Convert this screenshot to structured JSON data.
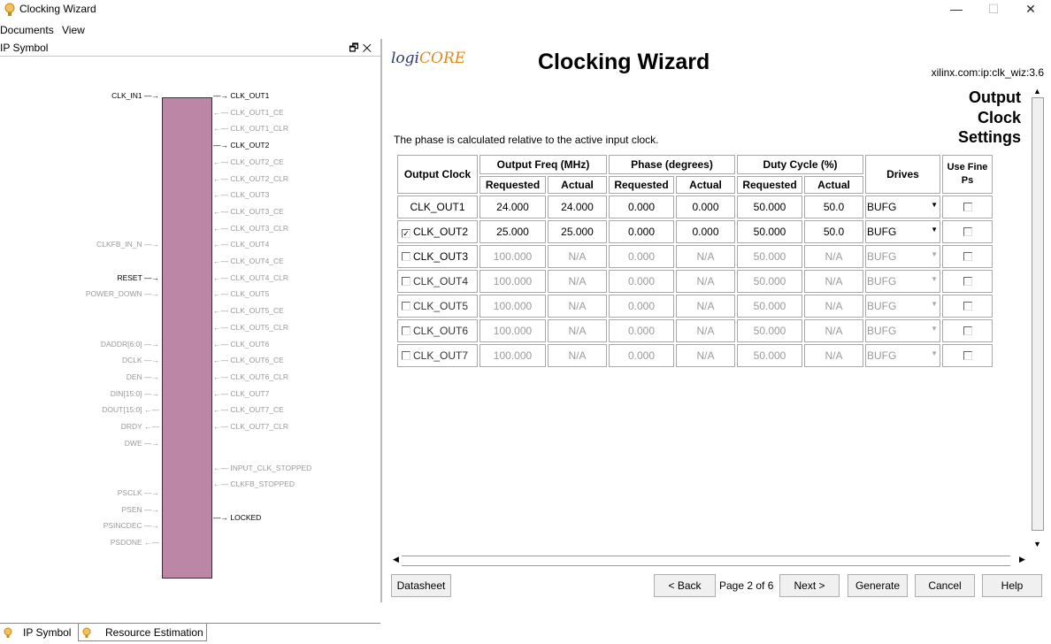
{
  "window": {
    "title": "Clocking Wizard",
    "controls": {
      "minimize": "—",
      "maximize": "☐",
      "close": "✕"
    }
  },
  "menu": [
    "Documents",
    "View"
  ],
  "left_panel": {
    "title": "IP Symbol",
    "header_buttons": "🗗✕",
    "inputs": [
      {
        "name": "CLK_IN1",
        "active": true
      },
      {
        "name": "CLKFB_IN_N",
        "active": false
      },
      {
        "name": "RESET",
        "active": true
      },
      {
        "name": "POWER_DOWN",
        "active": false
      },
      {
        "name": "DADDR[6:0]",
        "active": false
      },
      {
        "name": "DCLK",
        "active": false
      },
      {
        "name": "DEN",
        "active": false
      },
      {
        "name": "DIN[15:0]",
        "active": false
      },
      {
        "name": "DOUT[15:0]",
        "active": false
      },
      {
        "name": "DRDY",
        "active": false
      },
      {
        "name": "DWE",
        "active": false
      },
      {
        "name": "PSCLK",
        "active": false
      },
      {
        "name": "PSEN",
        "active": false
      },
      {
        "name": "PSINCDEC",
        "active": false
      },
      {
        "name": "PSDONE",
        "active": false
      }
    ],
    "outputs": [
      {
        "name": "CLK_OUT1",
        "active": true
      },
      {
        "name": "CLK_OUT1_CE",
        "active": false
      },
      {
        "name": "CLK_OUT1_CLR",
        "active": false
      },
      {
        "name": "CLK_OUT2",
        "active": true
      },
      {
        "name": "CLK_OUT2_CE",
        "active": false
      },
      {
        "name": "CLK_OUT2_CLR",
        "active": false
      },
      {
        "name": "CLK_OUT3",
        "active": false
      },
      {
        "name": "CLK_OUT3_CE",
        "active": false
      },
      {
        "name": "CLK_OUT3_CLR",
        "active": false
      },
      {
        "name": "CLK_OUT4",
        "active": false
      },
      {
        "name": "CLK_OUT4_CE",
        "active": false
      },
      {
        "name": "CLK_OUT4_CLR",
        "active": false
      },
      {
        "name": "CLK_OUT5",
        "active": false
      },
      {
        "name": "CLK_OUT5_CE",
        "active": false
      },
      {
        "name": "CLK_OUT5_CLR",
        "active": false
      },
      {
        "name": "CLK_OUT6",
        "active": false
      },
      {
        "name": "CLK_OUT6_CE",
        "active": false
      },
      {
        "name": "CLK_OUT6_CLR",
        "active": false
      },
      {
        "name": "CLK_OUT7",
        "active": false
      },
      {
        "name": "CLK_OUT7_CE",
        "active": false
      },
      {
        "name": "CLK_OUT7_CLR",
        "active": false
      },
      {
        "name": "INPUT_CLK_STOPPED",
        "active": false
      },
      {
        "name": "CLKFB_STOPPED",
        "active": false
      },
      {
        "name": "LOCKED",
        "active": true
      }
    ],
    "tabs": [
      "IP Symbol",
      "Resource Estimation"
    ]
  },
  "right_panel": {
    "logo_a": "logi",
    "logo_b": "CORE",
    "title": "Clocking Wizard",
    "ip_id": "xilinx.com:ip:clk_wiz:3.6",
    "section_line1": "Output",
    "section_line2": "Clock",
    "section_line3": "Settings",
    "phase_note": "The phase is calculated relative to the active input clock.",
    "headers": {
      "output_clock": "Output Clock",
      "output_freq": "Output Freq (MHz)",
      "phase": "Phase (degrees)",
      "duty": "Duty Cycle (%)",
      "drives": "Drives",
      "use_fine_ps": "Use Fine Ps",
      "requested": "Requested",
      "actual": "Actual"
    },
    "rows": [
      {
        "name": "CLK_OUT1",
        "enabled": true,
        "has_check": false,
        "checked": false,
        "freq_req": "24.000",
        "freq_act": "24.000",
        "phase_req": "0.000",
        "phase_act": "0.000",
        "duty_req": "50.000",
        "duty_act": "50.0",
        "drives": "BUFG"
      },
      {
        "name": "CLK_OUT2",
        "enabled": true,
        "has_check": true,
        "checked": true,
        "freq_req": "25.000",
        "freq_act": "25.000",
        "phase_req": "0.000",
        "phase_act": "0.000",
        "duty_req": "50.000",
        "duty_act": "50.0",
        "drives": "BUFG"
      },
      {
        "name": "CLK_OUT3",
        "enabled": false,
        "has_check": true,
        "checked": false,
        "freq_req": "100.000",
        "freq_act": "N/A",
        "phase_req": "0.000",
        "phase_act": "N/A",
        "duty_req": "50.000",
        "duty_act": "N/A",
        "drives": "BUFG"
      },
      {
        "name": "CLK_OUT4",
        "enabled": false,
        "has_check": true,
        "checked": false,
        "freq_req": "100.000",
        "freq_act": "N/A",
        "phase_req": "0.000",
        "phase_act": "N/A",
        "duty_req": "50.000",
        "duty_act": "N/A",
        "drives": "BUFG"
      },
      {
        "name": "CLK_OUT5",
        "enabled": false,
        "has_check": true,
        "checked": false,
        "freq_req": "100.000",
        "freq_act": "N/A",
        "phase_req": "0.000",
        "phase_act": "N/A",
        "duty_req": "50.000",
        "duty_act": "N/A",
        "drives": "BUFG"
      },
      {
        "name": "CLK_OUT6",
        "enabled": false,
        "has_check": true,
        "checked": false,
        "freq_req": "100.000",
        "freq_act": "N/A",
        "phase_req": "0.000",
        "phase_act": "N/A",
        "duty_req": "50.000",
        "duty_act": "N/A",
        "drives": "BUFG"
      },
      {
        "name": "CLK_OUT7",
        "enabled": false,
        "has_check": true,
        "checked": false,
        "freq_req": "100.000",
        "freq_act": "N/A",
        "phase_req": "0.000",
        "phase_act": "N/A",
        "duty_req": "50.000",
        "duty_act": "N/A",
        "drives": "BUFG"
      }
    ],
    "footer": {
      "datasheet": "Datasheet",
      "back": "< Back",
      "page": "Page 2 of 6",
      "next": "Next >",
      "generate": "Generate",
      "cancel": "Cancel",
      "help": "Help"
    }
  },
  "colors": {
    "ip_block": "#bc86a6",
    "logo_orange": "#e08a1e",
    "logo_blue": "#2b3a66"
  }
}
